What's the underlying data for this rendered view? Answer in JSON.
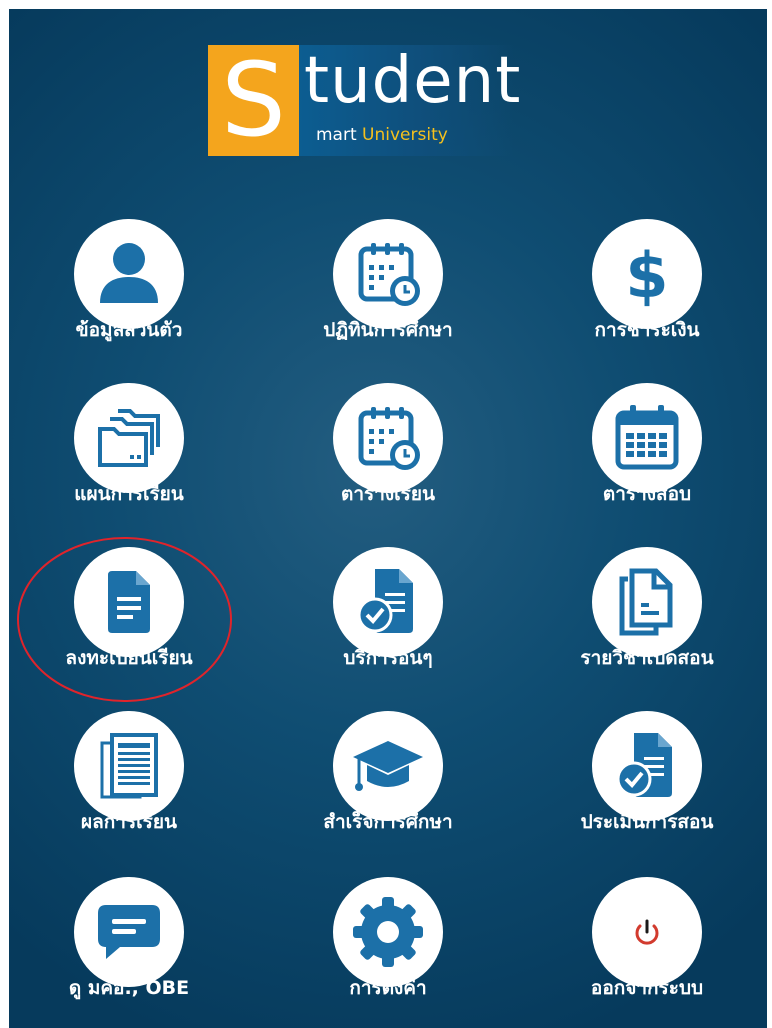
{
  "logo": {
    "letter": "S",
    "word": "tudent",
    "sub_prefix": "mart",
    "sub_suffix": "University"
  },
  "menu": [
    {
      "label": "ข้อมูลส่วนตัว",
      "icon": "user-icon"
    },
    {
      "label": "ปฏิทินการศึกษา",
      "icon": "calendar-clock-icon"
    },
    {
      "label": "การชำระเงิน",
      "icon": "dollar-icon"
    },
    {
      "label": "แผนการเรียน",
      "icon": "folders-icon"
    },
    {
      "label": "ตารางเรียน",
      "icon": "calendar-clock-icon"
    },
    {
      "label": "ตารางสอบ",
      "icon": "calendar-grid-icon"
    },
    {
      "label": "ลงทะเบียนเรียน",
      "icon": "document-icon"
    },
    {
      "label": "บริการอื่นๆ",
      "icon": "document-check-icon"
    },
    {
      "label": "รายวิชาเปิดสอน",
      "icon": "copy-document-icon"
    },
    {
      "label": "ผลการเรียน",
      "icon": "report-list-icon"
    },
    {
      "label": "สำเร็จการศึกษา",
      "icon": "graduation-cap-icon"
    },
    {
      "label": "ประเมินการสอน",
      "icon": "document-check-icon"
    },
    {
      "label": "ดู มคอ., OBE",
      "icon": "chat-icon"
    },
    {
      "label": "การตั้งค่า",
      "icon": "gear-icon"
    },
    {
      "label": "ออกจากระบบ",
      "icon": "power-icon"
    }
  ],
  "colors": {
    "background": "#0f4d72",
    "icon": "#1c70a8",
    "accent": "#f4a51d",
    "highlight": "#e0242b"
  }
}
